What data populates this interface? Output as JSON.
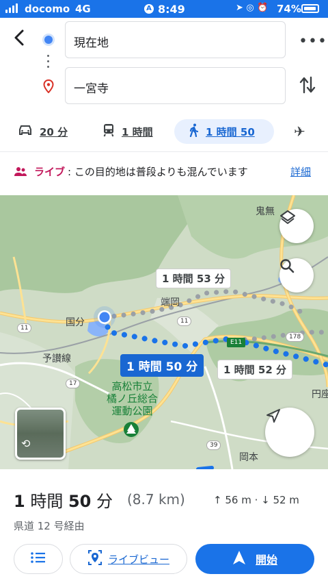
{
  "status_bar": {
    "carrier": "docomo",
    "network": "4G",
    "time": "8:49",
    "battery_percent": "74%",
    "battery_level": 0.74
  },
  "directions": {
    "origin": "現在地",
    "destination": "一宮寺"
  },
  "modes": [
    {
      "icon": "car-icon",
      "label": "20 分"
    },
    {
      "icon": "train-icon",
      "label": "1 時間"
    },
    {
      "icon": "walk-icon",
      "label": "1 時間 50",
      "selected": true
    },
    {
      "icon": "flight-icon",
      "label": ""
    }
  ],
  "live": {
    "label": "ライブ",
    "message": ": この目的地は普段よりも混んでいます",
    "details_link": "詳細"
  },
  "map": {
    "route_labels": {
      "selected": "1 時間 50 分",
      "alt1": "1 時間 53 分",
      "alt2": "1 時間 52 分"
    },
    "places": {
      "onibuna": "鬼無",
      "hataoka": "端岡",
      "kokubun": "国分",
      "yosan_line": "予讃線",
      "park": "高松市立\n橘ノ丘総合\n運動公園",
      "okamoto": "岡本",
      "enza": "円座"
    },
    "road_shields": {
      "r11a": "11",
      "r11b": "11",
      "r17": "17",
      "r39": "39",
      "e11": "E11",
      "r178": "178"
    },
    "colors": {
      "route_selected": "#1a73e8",
      "route_alt": "#9aa0a6",
      "current_location": "#4285f4"
    }
  },
  "summary": {
    "duration_num1": "1",
    "duration_unit1": " 時間 ",
    "duration_num2": "50",
    "duration_unit2": " 分",
    "distance": "(8.7 km)",
    "elevation": "↑ 56 m · ↓ 52 m",
    "via": "県道 12 号経由"
  },
  "actions": {
    "live_view": "ライブビュー",
    "start": "開始"
  }
}
